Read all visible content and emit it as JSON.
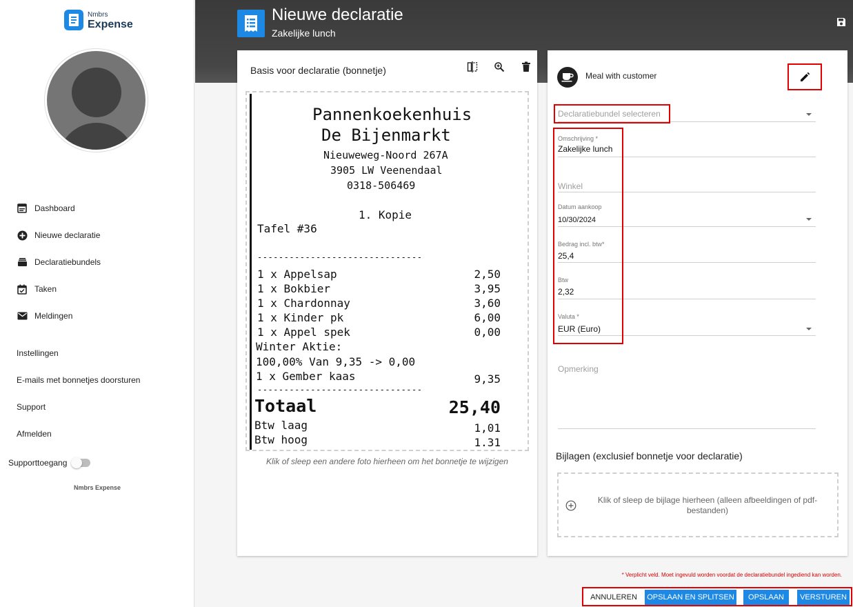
{
  "app": {
    "logo_line1": "Nmbrs",
    "logo_line2": "Expense",
    "footer": "Nmbrs Expense"
  },
  "sidebar": {
    "nav": [
      {
        "label": "Dashboard",
        "icon": "dashboard-icon"
      },
      {
        "label": "Nieuwe declaratie",
        "icon": "add-circle-icon"
      },
      {
        "label": "Declaratiebundels",
        "icon": "bundle-icon"
      },
      {
        "label": "Taken",
        "icon": "calendar-check-icon"
      },
      {
        "label": "Meldingen",
        "icon": "mail-icon"
      }
    ],
    "links": [
      "Instellingen",
      "E-mails met bonnetjes doorsturen",
      "Support",
      "Afmelden"
    ],
    "support_access": {
      "label": "Supporttoegang",
      "enabled": false
    }
  },
  "header": {
    "title": "Nieuwe declaratie",
    "subtitle": "Zakelijke lunch"
  },
  "receipt_panel": {
    "title": "Basis voor declaratie (bonnetje)",
    "drop_hint": "Klik of sleep een andere foto hierheen om het bonnetje te wijzigen",
    "receipt": {
      "shop_name_1": "Pannenkoekenhuis",
      "shop_name_2": "De Bijenmarkt",
      "address_1": "Nieuweweg-Noord 267A",
      "address_2": "3905 LW Veenendaal",
      "phone": "0318-506469",
      "copy": "1. Kopie",
      "table": "Tafel #36",
      "separator": "-------------------------------",
      "items": [
        {
          "name": "1 x Appelsap",
          "price": "2,50"
        },
        {
          "name": "1 x Bokbier",
          "price": "3,95"
        },
        {
          "name": "1 x Chardonnay",
          "price": "3,60"
        },
        {
          "name": "1 x Kinder pk",
          "price": "6,00"
        },
        {
          "name": "1 x Appel spek",
          "price": "0,00"
        }
      ],
      "promo_1": "Winter Aktie:",
      "promo_2": "100,00% Van 9,35 -> 0,00",
      "extra_item": {
        "name": "1 x Gember kaas",
        "price": "9,35"
      },
      "total_label": "Totaal",
      "total_value": "25,40",
      "vat_low_label": "Btw laag",
      "vat_low_value": "1,01",
      "vat_high_label": "Btw hoog",
      "vat_high_value": "1.31"
    }
  },
  "form": {
    "category": "Meal with customer",
    "bundle_placeholder": "Declaratiebundel selecteren",
    "description": {
      "label": "Omschrijving *",
      "value": "Zakelijke lunch"
    },
    "shop": {
      "placeholder": "Winkel"
    },
    "purchase_date": {
      "label": "Datum aankoop",
      "value": "10/30/2024"
    },
    "amount": {
      "label": "Bedrag incl. btw*",
      "value": "25,4"
    },
    "vat": {
      "label": "Btw",
      "value": "2,32"
    },
    "currency": {
      "label": "Valuta *",
      "value": "EUR (Euro)"
    },
    "remark": {
      "placeholder": "Opmerking"
    },
    "attachments_title": "Bijlagen (exclusief bonnetje voor declaratie)",
    "attachments_hint": "Klik of sleep de bijlage hierheen (alleen afbeeldingen of pdf-bestanden)"
  },
  "footer": {
    "required_note": "* Verplicht veld. Moet ingevuld worden voordat de declaratiebundel ingediend kan worden.",
    "cancel": "ANNULEREN",
    "save_split": "OPSLAAN EN SPLITSEN",
    "save": "OPSLAAN",
    "send": "VERSTUREN"
  },
  "colors": {
    "accent": "#1e88e5",
    "highlight": "#e00000",
    "header_bg": "#3a3a3a"
  }
}
